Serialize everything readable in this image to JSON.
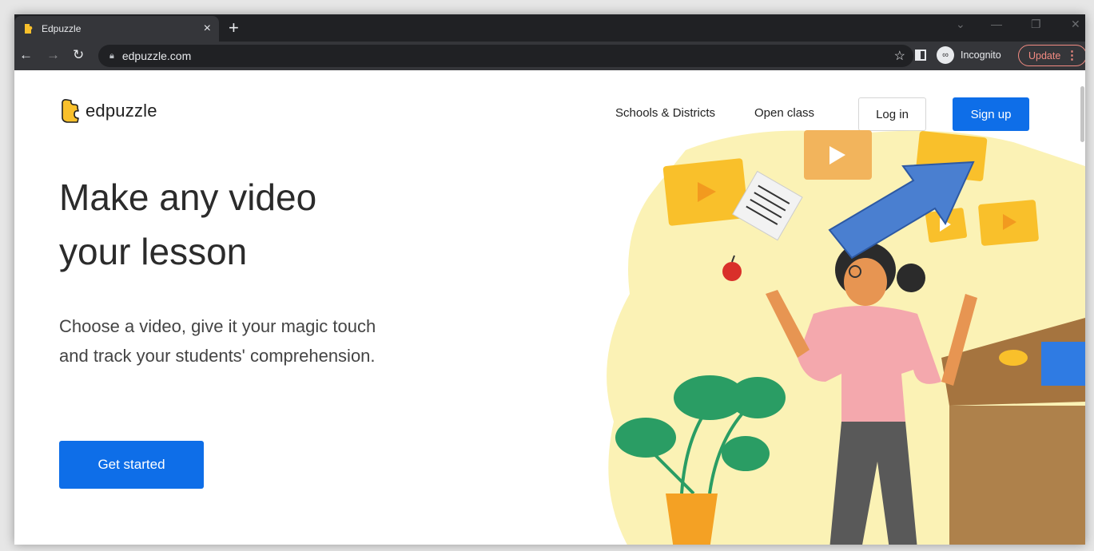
{
  "browser": {
    "tab_title": "Edpuzzle",
    "tab_close": "×",
    "new_tab": "+",
    "url": "edpuzzle.com",
    "profile_label": "Incognito",
    "update_label": "Update"
  },
  "header": {
    "logo_text": "edpuzzle",
    "nav": [
      "Schools & Districts",
      "Open class"
    ],
    "login_label": "Log in",
    "signup_label": "Sign up"
  },
  "hero": {
    "title": "Make any video your lesson",
    "subtitle": "Choose a video, give it your magic touch and track your students' comprehension.",
    "cta_label": "Get started"
  },
  "icons": {
    "favicon": "edpuzzle-puzzle-icon",
    "star": "bookmark-star-icon",
    "incognito": "incognito-icon",
    "annotation": "blue-arrow-pointing-to-sign-up"
  },
  "colors": {
    "brand_blue": "#0e6ee8",
    "brand_yellow": "#f9c02b",
    "chrome_dark": "#202124",
    "update_red": "#f28b82"
  }
}
